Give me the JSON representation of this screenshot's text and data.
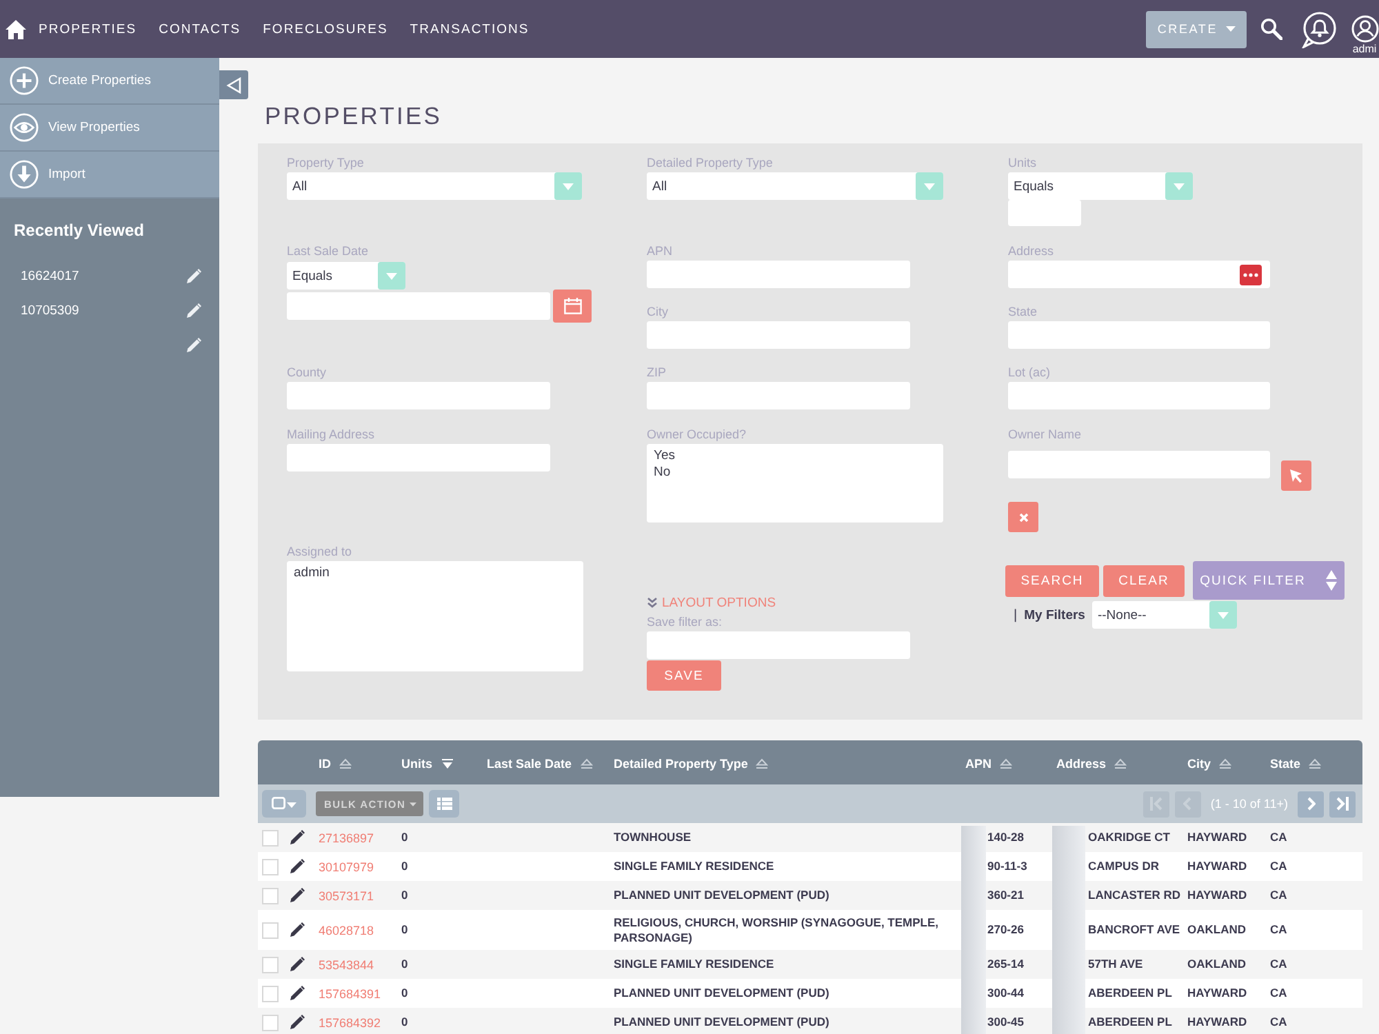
{
  "top_nav": {
    "items": [
      {
        "label": "PROPERTIES"
      },
      {
        "label": "CONTACTS"
      },
      {
        "label": "FORECLOSURES"
      },
      {
        "label": "TRANSACTIONS"
      }
    ],
    "create_button": "CREATE",
    "user_label": "admi"
  },
  "sidebar": {
    "actions": [
      {
        "kind": "create",
        "label": "Create Properties"
      },
      {
        "kind": "view",
        "label": "View Properties"
      },
      {
        "kind": "import",
        "label": "Import"
      }
    ],
    "recent_title": "Recently Viewed",
    "recent_items": [
      {
        "kind": "record",
        "label": "16624017"
      },
      {
        "kind": "record",
        "label": "10705309"
      },
      {
        "kind": "edit_only"
      }
    ]
  },
  "page_title": "PROPERTIES",
  "filter": {
    "columns": [
      [
        {
          "kind": "select",
          "label": "Property Type",
          "value": "All"
        },
        {
          "kind": "date",
          "label": "Last Sale Date",
          "operator": "Equals"
        },
        {
          "kind": "text",
          "label": "County"
        },
        {
          "kind": "text",
          "label": "Mailing Address"
        },
        {
          "kind": "listbox",
          "label": "Assigned to",
          "options": [
            "admin"
          ]
        }
      ],
      [
        {
          "kind": "select",
          "label": "Detailed Property Type",
          "value": "All"
        },
        {
          "kind": "text",
          "label": "APN"
        },
        {
          "kind": "text",
          "label": "City"
        },
        {
          "kind": "text",
          "label": "ZIP"
        },
        {
          "kind": "listbox",
          "label": "Owner Occupied?",
          "options": [
            "Yes",
            "No"
          ]
        }
      ],
      [
        {
          "kind": "range_select",
          "label": "Units",
          "operator": "Equals"
        },
        {
          "kind": "lookup",
          "label": "Address"
        },
        {
          "kind": "text",
          "label": "State"
        },
        {
          "kind": "text",
          "label": "Lot (ac)"
        },
        {
          "kind": "person",
          "label": "Owner Name"
        }
      ]
    ],
    "layout_options": {
      "label": "LAYOUT OPTIONS",
      "save_label": "Save filter as:",
      "save_button": "SAVE"
    },
    "actions": {
      "buttons": [
        {
          "kind": "search",
          "label": "SEARCH"
        },
        {
          "kind": "clear",
          "label": "CLEAR"
        },
        {
          "kind": "quick",
          "label": "QUICK FILTER"
        }
      ],
      "separator": "|",
      "my_filters_label": "My Filters",
      "my_filters_value": "--None--"
    }
  },
  "table": {
    "columns": [
      {
        "label": "ID",
        "sorted": false
      },
      {
        "label": "Units",
        "sorted": true
      },
      {
        "label": "Last Sale Date",
        "sorted": false
      },
      {
        "label": "Detailed Property Type",
        "sorted": false
      },
      {
        "label": "APN",
        "sorted": false
      },
      {
        "label": "Address",
        "sorted": false
      },
      {
        "label": "City",
        "sorted": false
      },
      {
        "label": "State",
        "sorted": false
      }
    ],
    "toolbar": {
      "bulk_action": {
        "label": "BULK ACTION",
        "disabled": true
      },
      "range": "(1 - 10 of 11+)",
      "pager": [
        {
          "kind": "first",
          "disabled": true
        },
        {
          "kind": "prev",
          "disabled": true
        },
        {
          "kind": "next",
          "disabled": false
        },
        {
          "kind": "last",
          "disabled": false
        }
      ]
    },
    "rows": [
      {
        "checked": false,
        "id": "27136897",
        "units": "0",
        "property_type": "TOWNHOUSE",
        "apn": "140-28",
        "address": "OAKRIDGE CT",
        "city": "HAYWARD",
        "state": "CA"
      },
      {
        "checked": false,
        "id": "30107979",
        "units": "0",
        "property_type": "SINGLE FAMILY RESIDENCE",
        "apn": "90-11-3",
        "address": "CAMPUS DR",
        "city": "HAYWARD",
        "state": "CA"
      },
      {
        "checked": false,
        "id": "30573171",
        "units": "0",
        "property_type": "PLANNED UNIT DEVELOPMENT (PUD)",
        "apn": "360-21",
        "address": "LANCASTER RD",
        "city": "HAYWARD",
        "state": "CA"
      },
      {
        "checked": false,
        "id": "46028718",
        "units": "0",
        "property_type": "RELIGIOUS, CHURCH, WORSHIP (SYNAGOGUE, TEMPLE, PARSONAGE)",
        "apn": "270-26",
        "address": "BANCROFT AVE",
        "city": "OAKLAND",
        "state": "CA"
      },
      {
        "checked": false,
        "id": "53543844",
        "units": "0",
        "property_type": "SINGLE FAMILY RESIDENCE",
        "apn": "265-14",
        "address": "57TH AVE",
        "city": "OAKLAND",
        "state": "CA"
      },
      {
        "checked": false,
        "id": "157684391",
        "units": "0",
        "property_type": "PLANNED UNIT DEVELOPMENT (PUD)",
        "apn": "300-44",
        "address": "ABERDEEN PL",
        "city": "HAYWARD",
        "state": "CA"
      },
      {
        "checked": false,
        "id": "157684392",
        "units": "0",
        "property_type": "PLANNED UNIT DEVELOPMENT (PUD)",
        "apn": "300-45",
        "address": "ABERDEEN PL",
        "city": "HAYWARD",
        "state": "CA"
      }
    ]
  }
}
